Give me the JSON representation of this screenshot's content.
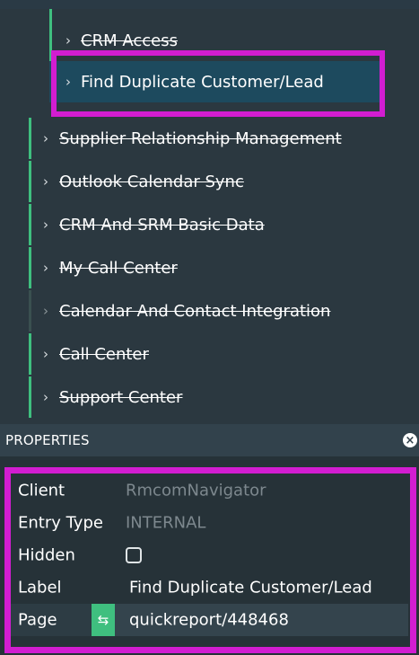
{
  "nav": {
    "items": [
      {
        "label": "CRM Access"
      },
      {
        "label": "Find Duplicate Customer/Lead"
      },
      {
        "label": "Supplier Relationship Management"
      },
      {
        "label": "Outlook Calendar Sync"
      },
      {
        "label": "CRM And SRM Basic Data"
      },
      {
        "label": "My Call Center"
      },
      {
        "label": "Calendar And Contact Integration"
      },
      {
        "label": "Call Center"
      },
      {
        "label": "Support Center"
      }
    ]
  },
  "properties": {
    "title": "PROPERTIES",
    "close_icon": "×",
    "rows": {
      "client": {
        "key": "Client",
        "value": "RmcomNavigator"
      },
      "entry_type": {
        "key": "Entry Type",
        "value": "INTERNAL"
      },
      "hidden": {
        "key": "Hidden",
        "checked": false
      },
      "label": {
        "key": "Label",
        "value": "Find Duplicate Customer/Lead"
      },
      "page": {
        "key": "Page",
        "value": "quickreport/448468"
      }
    }
  },
  "icons": {
    "chevron": "chevron-right-icon",
    "swap": "swap-arrows-icon",
    "close": "close-icon"
  },
  "colors": {
    "accent_green": "#3fbf7f",
    "highlight": "#d21dd1",
    "selected_bg": "#1d4a5e",
    "dim_text": "#7d888e"
  }
}
